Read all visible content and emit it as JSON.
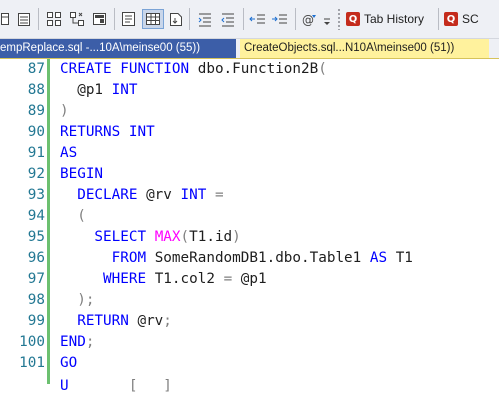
{
  "toolbar": {
    "tab_history_label": "Tab History",
    "sc_label": "SC"
  },
  "tabs": [
    {
      "label": "empReplace.sql -...10A\\meinse00 (55))"
    },
    {
      "label": "CreateObjects.sql...N10A\\meinse00 (51))"
    }
  ],
  "editor": {
    "lines": [
      {
        "number": "87",
        "tokens": [
          [
            "kw",
            "CREATE FUNCTION "
          ],
          [
            "t",
            "dbo.Function2B"
          ],
          [
            "sym",
            "("
          ]
        ]
      },
      {
        "number": "88",
        "tokens": [
          [
            "t",
            "  @p1 "
          ],
          [
            "kw",
            "INT"
          ]
        ]
      },
      {
        "number": "89",
        "tokens": [
          [
            "sym",
            ")"
          ]
        ]
      },
      {
        "number": "90",
        "tokens": [
          [
            "kw",
            "RETURNS INT"
          ]
        ]
      },
      {
        "number": "91",
        "tokens": [
          [
            "kw",
            "AS"
          ]
        ]
      },
      {
        "number": "92",
        "tokens": [
          [
            "kw",
            "BEGIN"
          ]
        ]
      },
      {
        "number": "93",
        "tokens": [
          [
            "kw",
            "  DECLARE "
          ],
          [
            "t",
            "@rv "
          ],
          [
            "kw",
            "INT "
          ],
          [
            "sym",
            "="
          ]
        ]
      },
      {
        "number": "94",
        "tokens": [
          [
            "sym",
            "  ("
          ]
        ]
      },
      {
        "number": "95",
        "tokens": [
          [
            "kw",
            "    SELECT "
          ],
          [
            "fn",
            "MAX"
          ],
          [
            "sym",
            "("
          ],
          [
            "t",
            "T1.id"
          ],
          [
            "sym",
            ")"
          ]
        ]
      },
      {
        "number": "96",
        "tokens": [
          [
            "kw",
            "      FROM "
          ],
          [
            "t",
            "SomeRandomDB1.dbo.Table1 "
          ],
          [
            "kw",
            "AS "
          ],
          [
            "t",
            "T1"
          ]
        ]
      },
      {
        "number": "97",
        "tokens": [
          [
            "kw",
            "     WHERE "
          ],
          [
            "t",
            "T1.col2 "
          ],
          [
            "sym",
            "= "
          ],
          [
            "t",
            "@p1"
          ]
        ]
      },
      {
        "number": "98",
        "tokens": [
          [
            "sym",
            "  );"
          ]
        ]
      },
      {
        "number": "99",
        "tokens": [
          [
            "kw",
            "  RETURN "
          ],
          [
            "t",
            "@rv"
          ],
          [
            "sym",
            ";"
          ]
        ]
      },
      {
        "number": "100",
        "tokens": [
          [
            "kw",
            "END"
          ],
          [
            "sym",
            ";"
          ]
        ]
      },
      {
        "number": "101",
        "tokens": [
          [
            "kw",
            "GO"
          ]
        ]
      }
    ],
    "partial_line": [
      [
        "kw",
        "U"
      ],
      [
        "t",
        "       "
      ],
      [
        "sym",
        "[   ]"
      ]
    ]
  },
  "colors": {
    "keyword": "#0000ff",
    "function": "#ff00ff",
    "operator": "#808080",
    "text": "#1e1e1e",
    "line_number": "#237893",
    "change_bar": "#6cc070",
    "active_tab": "#fff29d",
    "inactive_tab": "#3c5ea8"
  }
}
